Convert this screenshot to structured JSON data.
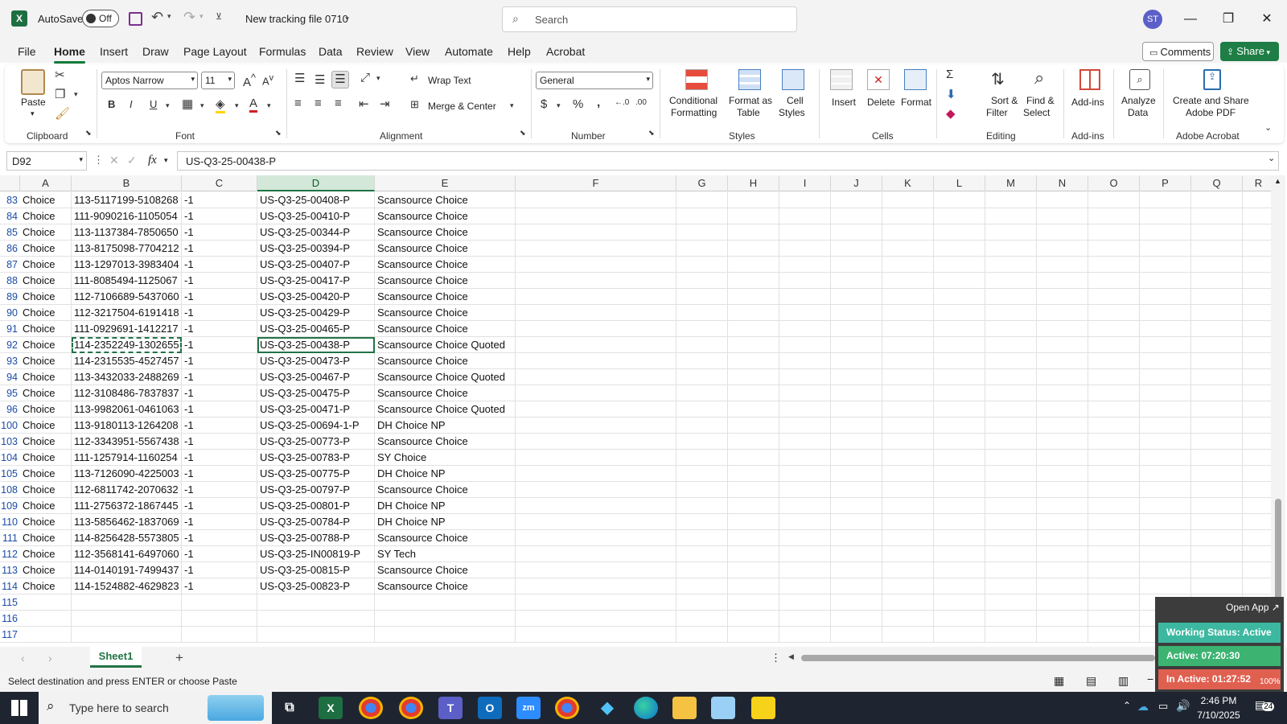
{
  "titlebar": {
    "autosave_label": "AutoSave",
    "autosave_state": "Off",
    "file_name": "New tracking file 0710",
    "search_placeholder": "Search",
    "user_initials": "ST"
  },
  "menu": {
    "tabs": [
      "File",
      "Home",
      "Insert",
      "Draw",
      "Page Layout",
      "Formulas",
      "Data",
      "Review",
      "View",
      "Automate",
      "Help",
      "Acrobat"
    ],
    "active_tab": "Home",
    "comments_label": "Comments",
    "share_label": "Share"
  },
  "ribbon": {
    "clipboard": {
      "paste": "Paste",
      "label": "Clipboard"
    },
    "font": {
      "name": "Aptos Narrow",
      "size": "11",
      "label": "Font"
    },
    "alignment": {
      "wrap_text": "Wrap Text",
      "merge_center": "Merge & Center",
      "label": "Alignment"
    },
    "number": {
      "format": "General",
      "label": "Number"
    },
    "styles": {
      "conditional": "Conditional",
      "formatting": "Formatting",
      "format_as": "Format as",
      "table": "Table",
      "cell": "Cell",
      "styles_word": "Styles",
      "label": "Styles"
    },
    "cells": {
      "insert": "Insert",
      "delete": "Delete",
      "format": "Format",
      "label": "Cells"
    },
    "editing": {
      "sort": "Sort &",
      "filter": "Filter",
      "find": "Find &",
      "select": "Select",
      "label": "Editing"
    },
    "addins": {
      "addins": "Add-ins",
      "label": "Add-ins"
    },
    "analyze": {
      "line1": "Analyze",
      "line2": "Data"
    },
    "acrobat": {
      "line1": "Create and Share",
      "line2": "Adobe PDF",
      "label": "Adobe Acrobat"
    }
  },
  "formula_bar": {
    "name_box": "D92",
    "fx": "fx",
    "value": "US-Q3-25-00438-P"
  },
  "columns": [
    "A",
    "B",
    "C",
    "D",
    "E",
    "F",
    "G",
    "H",
    "I",
    "J",
    "K",
    "L",
    "M",
    "N",
    "O",
    "P",
    "Q",
    "R"
  ],
  "selected_column": "D",
  "active_cell": {
    "row": "92",
    "col": "D"
  },
  "copy_cell": {
    "row": "92",
    "col": "B"
  },
  "rows": [
    {
      "n": "83",
      "a": "Choice",
      "b": "113-5117199-5108268",
      "c": "-1",
      "d": "US-Q3-25-00408-P",
      "e": "Scansource Choice"
    },
    {
      "n": "84",
      "a": "Choice",
      "b": "111-9090216-1105054",
      "c": "-1",
      "d": "US-Q3-25-00410-P",
      "e": "Scansource Choice"
    },
    {
      "n": "85",
      "a": "Choice",
      "b": "113-1137384-7850650",
      "c": "-1",
      "d": "US-Q3-25-00344-P",
      "e": "Scansource Choice"
    },
    {
      "n": "86",
      "a": "Choice",
      "b": "113-8175098-7704212",
      "c": "-1",
      "d": "US-Q3-25-00394-P",
      "e": "Scansource Choice"
    },
    {
      "n": "87",
      "a": "Choice",
      "b": "113-1297013-3983404",
      "c": "-1",
      "d": "US-Q3-25-00407-P",
      "e": "Scansource Choice"
    },
    {
      "n": "88",
      "a": "Choice",
      "b": "111-8085494-1125067",
      "c": "-1",
      "d": "US-Q3-25-00417-P",
      "e": "Scansource Choice"
    },
    {
      "n": "89",
      "a": "Choice",
      "b": "112-7106689-5437060",
      "c": "-1",
      "d": "US-Q3-25-00420-P",
      "e": "Scansource Choice"
    },
    {
      "n": "90",
      "a": "Choice",
      "b": "112-3217504-6191418",
      "c": "-1",
      "d": "US-Q3-25-00429-P",
      "e": "Scansource Choice"
    },
    {
      "n": "91",
      "a": "Choice",
      "b": "111-0929691-1412217",
      "c": "-1",
      "d": "US-Q3-25-00465-P",
      "e": "Scansource Choice"
    },
    {
      "n": "92",
      "a": "Choice",
      "b": "114-2352249-1302655",
      "c": "-1",
      "d": "US-Q3-25-00438-P",
      "e": "Scansource Choice Quoted"
    },
    {
      "n": "93",
      "a": "Choice",
      "b": "114-2315535-4527457",
      "c": "-1",
      "d": "US-Q3-25-00473-P",
      "e": "Scansource Choice"
    },
    {
      "n": "94",
      "a": "Choice",
      "b": "113-3432033-2488269",
      "c": "-1",
      "d": "US-Q3-25-00467-P",
      "e": "Scansource Choice Quoted"
    },
    {
      "n": "95",
      "a": "Choice",
      "b": "112-3108486-7837837",
      "c": "-1",
      "d": "US-Q3-25-00475-P",
      "e": "Scansource Choice"
    },
    {
      "n": "96",
      "a": "Choice",
      "b": "113-9982061-0461063",
      "c": "-1",
      "d": "US-Q3-25-00471-P",
      "e": "Scansource Choice Quoted"
    },
    {
      "n": "100",
      "a": "Choice",
      "b": "113-9180113-1264208",
      "c": "-1",
      "d": "US-Q3-25-00694-1-P",
      "e": "DH Choice NP"
    },
    {
      "n": "103",
      "a": "Choice",
      "b": "112-3343951-5567438",
      "c": "-1",
      "d": "US-Q3-25-00773-P",
      "e": "Scansource Choice"
    },
    {
      "n": "104",
      "a": "Choice",
      "b": "111-1257914-1160254",
      "c": "-1",
      "d": "US-Q3-25-00783-P",
      "e": "SY Choice"
    },
    {
      "n": "105",
      "a": "Choice",
      "b": "113-7126090-4225003",
      "c": "-1",
      "d": "US-Q3-25-00775-P",
      "e": "DH Choice NP"
    },
    {
      "n": "108",
      "a": "Choice",
      "b": "112-6811742-2070632",
      "c": "-1",
      "d": "US-Q3-25-00797-P",
      "e": "Scansource Choice"
    },
    {
      "n": "109",
      "a": "Choice",
      "b": "111-2756372-1867445",
      "c": "-1",
      "d": "US-Q3-25-00801-P",
      "e": "DH Choice NP"
    },
    {
      "n": "110",
      "a": "Choice",
      "b": "113-5856462-1837069",
      "c": "-1",
      "d": "US-Q3-25-00784-P",
      "e": "DH Choice NP"
    },
    {
      "n": "111",
      "a": "Choice",
      "b": "114-8256428-5573805",
      "c": "-1",
      "d": "US-Q3-25-00788-P",
      "e": "Scansource Choice"
    },
    {
      "n": "112",
      "a": "Choice",
      "b": "112-3568141-6497060",
      "c": "-1",
      "d": "US-Q3-25-IN00819-P",
      "e": "SY Tech"
    },
    {
      "n": "113",
      "a": "Choice",
      "b": "114-0140191-7499437",
      "c": "-1",
      "d": "US-Q3-25-00815-P",
      "e": "Scansource Choice"
    },
    {
      "n": "114",
      "a": "Choice",
      "b": "114-1524882-4629823",
      "c": "-1",
      "d": "US-Q3-25-00823-P",
      "e": "Scansource Choice"
    },
    {
      "n": "115",
      "a": "",
      "b": "",
      "c": "",
      "d": "",
      "e": ""
    },
    {
      "n": "116",
      "a": "",
      "b": "",
      "c": "",
      "d": "",
      "e": ""
    },
    {
      "n": "117",
      "a": "",
      "b": "",
      "c": "",
      "d": "",
      "e": ""
    }
  ],
  "sheet_tabs": {
    "active": "Sheet1",
    "add": "+"
  },
  "status": {
    "message": "Select destination and press ENTER or choose Paste"
  },
  "widget": {
    "open_app": "Open App",
    "working_status": "Working Status: Active",
    "active": "Active: 07:20:30",
    "inactive": "In Active: 01:27:52",
    "zoom": "100%"
  },
  "taskbar": {
    "search_placeholder": "Type here to search",
    "time": "2:46 PM",
    "date": "7/10/2025",
    "notifications": "24"
  },
  "colors": {
    "excel_green": "#217346",
    "share_green": "#1e7e45",
    "widget_green": "#3cb371",
    "widget_teal": "#3db8a0",
    "widget_red": "#e06050"
  }
}
